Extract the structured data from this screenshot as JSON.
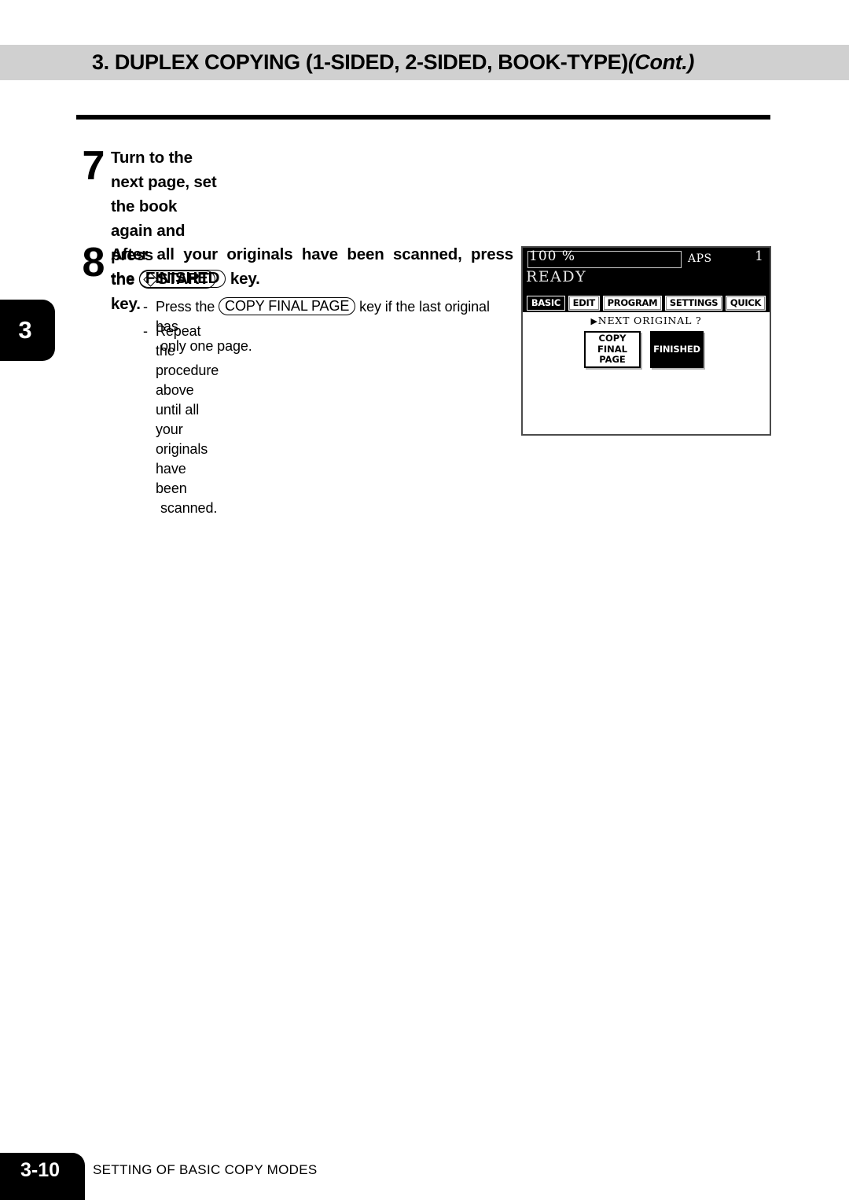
{
  "header": {
    "title_full": "3. DUPLEX COPYING (1-SIDED, 2-SIDED, BOOK-TYPE) (Cont.)",
    "title_main": "3. DUPLEX COPYING (1-SIDED, 2-SIDED, BOOK-TYPE)",
    "title_cont": "(Cont.)"
  },
  "chapter_tab": {
    "number": "3"
  },
  "steps": [
    {
      "number": "7",
      "head_line1": "Turn to the next page, set the book again and press",
      "head_line2_pre": "the",
      "head_key": "START",
      "head_key_icon": "diamond-start-icon",
      "head_line2_post": "key.",
      "sub_dash": "-",
      "sub_line1": "Repeat the  procedure above until all your originals have been",
      "sub_line2": "scanned."
    },
    {
      "number": "8",
      "head_line1": "After all your originals have been scanned, press",
      "head_line2_pre": "the",
      "head_key": "FINISHED",
      "head_line2_post": "key.",
      "sub_dash": "-",
      "sub_pre": "Press the",
      "sub_key": "COPY FINAL PAGE",
      "sub_post": "key if the last original has",
      "sub_line2": "only one page."
    }
  ],
  "lcd": {
    "ratio": "100 %",
    "copy_count": "1",
    "paper_mode": "APS",
    "status": "READY",
    "tabs": [
      {
        "label": "BASIC",
        "selected": true
      },
      {
        "label": "EDIT",
        "selected": false
      },
      {
        "label": "PROGRAM",
        "selected": false
      },
      {
        "label": "SETTINGS",
        "selected": false
      },
      {
        "label": "QUICK",
        "selected": false
      }
    ],
    "prompt_arrow": "▶",
    "prompt": "NEXT ORIGINAL ?",
    "buttons": {
      "copy_final_page_line1": "COPY",
      "copy_final_page_line2": "FINAL",
      "copy_final_page_line3": "PAGE",
      "finished": "FINISHED"
    }
  },
  "footer": {
    "page_number": "3-10",
    "caption": "SETTING OF BASIC COPY MODES"
  },
  "colors": {
    "header_bar": "#d0d0d0",
    "ink": "#000000",
    "paper": "#ffffff",
    "lcd_border": "#4b4b4b"
  }
}
